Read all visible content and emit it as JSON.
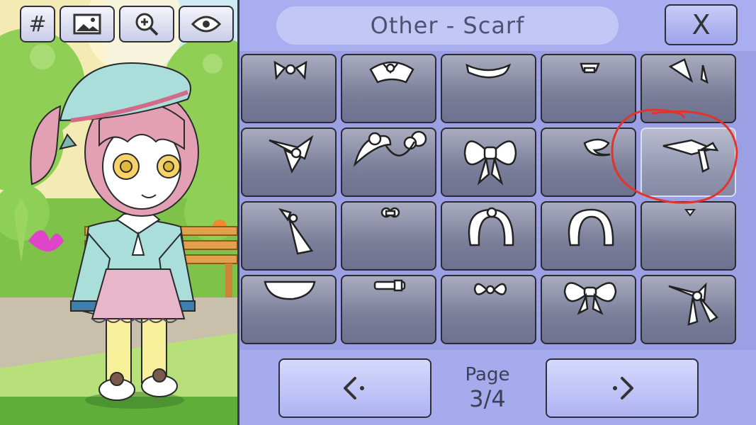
{
  "toolbar": {
    "hash_label": "#",
    "buttons": [
      "hash-button",
      "background-button",
      "zoom-button",
      "visibility-button"
    ]
  },
  "panel": {
    "title": "Other - Scarf",
    "close_label": "X"
  },
  "grid": {
    "rows": 4,
    "columns": 5,
    "selected_index": 9,
    "items": [
      "small-bow",
      "frilled-bow",
      "curved-scarf",
      "tiny-brooch",
      "split-collar",
      "sailor-knot",
      "fluffy-chain-collar",
      "large-bow",
      "curl-scarf",
      "sailor-collar-tie",
      "long-tie",
      "small-pom",
      "fluffy-scarf-a",
      "fluffy-scarf-b",
      "tiny-pin",
      "flat-collar",
      "belt-choker",
      "small-bow-b",
      "big-bow",
      "knotted-scarf"
    ]
  },
  "pagination": {
    "page_word": "Page",
    "current": "3/4",
    "prev_icon": "chevron-left-icon",
    "next_icon": "chevron-right-icon"
  },
  "colors": {
    "panel_bg": "#9ba0e4",
    "cell_bg": "#7a7d98",
    "highlight_circle": "#e2342d"
  }
}
